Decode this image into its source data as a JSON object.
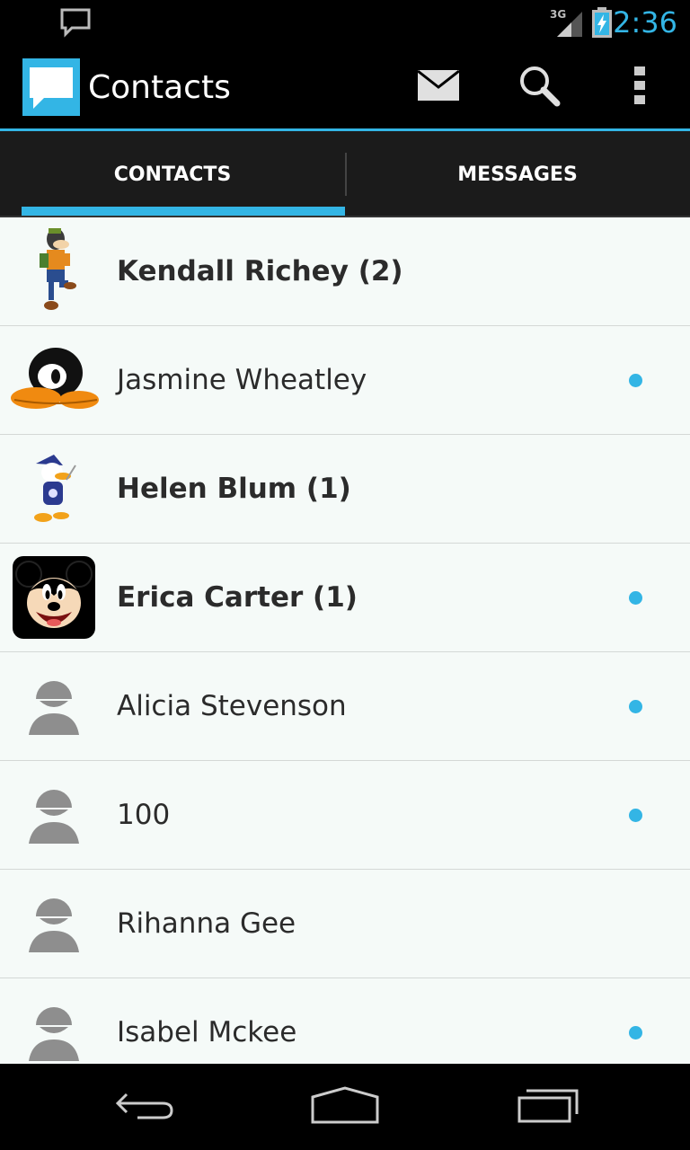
{
  "status_bar": {
    "time": "2:36",
    "network": "3G",
    "icons": [
      "notification-chat-icon",
      "signal-icon",
      "battery-charging-icon"
    ]
  },
  "action_bar": {
    "title": "Contacts",
    "app_icon": "chat-bubble-icon",
    "actions": [
      "mail-icon",
      "search-icon",
      "overflow-menu-icon"
    ]
  },
  "tabs": [
    {
      "label": "CONTACTS",
      "selected": true
    },
    {
      "label": "MESSAGES",
      "selected": false
    }
  ],
  "contacts": [
    {
      "name": "Kendall Richey (2)",
      "bold": true,
      "dot": false,
      "avatar": "goofy-avatar"
    },
    {
      "name": "Jasmine Wheatley",
      "bold": false,
      "dot": true,
      "avatar": "daffy-duck-avatar"
    },
    {
      "name": "Helen Blum (1)",
      "bold": true,
      "dot": false,
      "avatar": "donald-duck-avatar"
    },
    {
      "name": "Erica Carter (1)",
      "bold": true,
      "dot": true,
      "avatar": "mickey-mouse-avatar"
    },
    {
      "name": "Alicia Stevenson",
      "bold": false,
      "dot": true,
      "avatar": "default-person-avatar"
    },
    {
      "name": "100",
      "bold": false,
      "dot": true,
      "avatar": "default-person-avatar"
    },
    {
      "name": "Rihanna Gee",
      "bold": false,
      "dot": false,
      "avatar": "default-person-avatar"
    },
    {
      "name": "Isabel Mckee",
      "bold": false,
      "dot": true,
      "avatar": "default-person-avatar"
    }
  ],
  "colors": {
    "accent": "#33b5e5",
    "list_background": "#f5faf8",
    "tab_background": "#1b1b1b"
  },
  "nav_bar": [
    "back-icon",
    "home-icon",
    "recent-apps-icon"
  ]
}
